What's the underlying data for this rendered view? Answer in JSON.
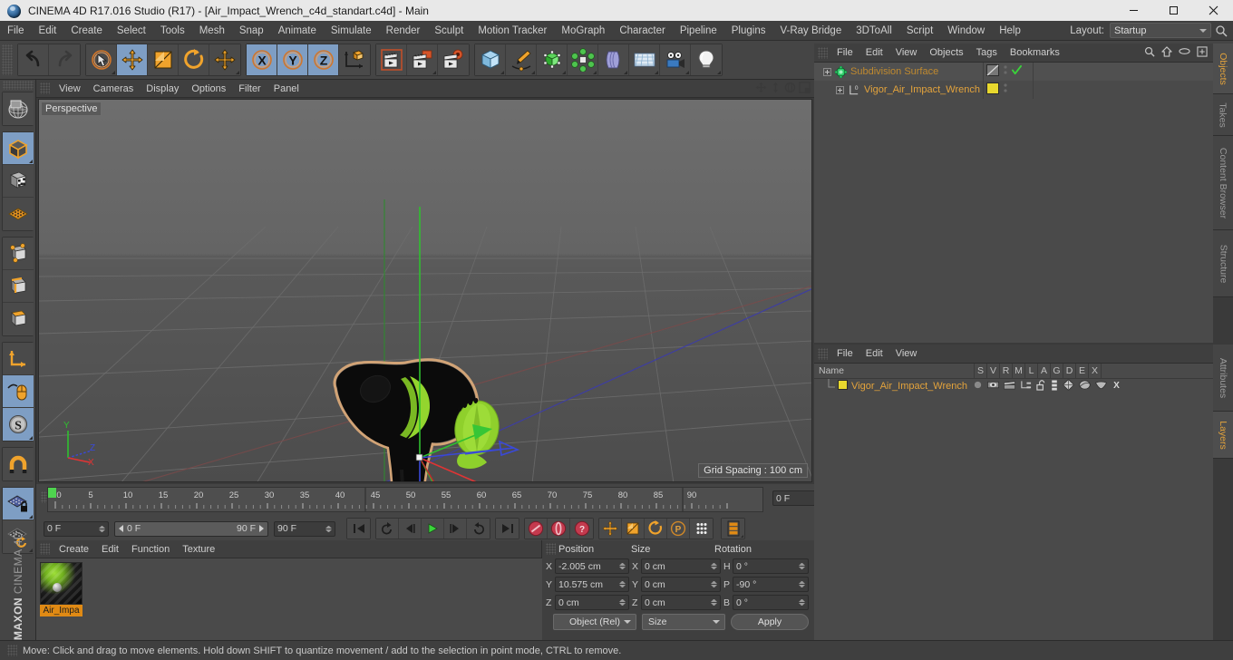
{
  "window": {
    "title": "CINEMA 4D R17.016 Studio (R17) - [Air_Impact_Wrench_c4d_standart.c4d] - Main",
    "minimize": "minimize-button",
    "maximize": "maximize-button",
    "close": "close-button"
  },
  "menubar": {
    "items": [
      "File",
      "Edit",
      "Create",
      "Select",
      "Tools",
      "Mesh",
      "Snap",
      "Animate",
      "Simulate",
      "Render",
      "Sculpt",
      "Motion Tracker",
      "MoGraph",
      "Character",
      "Pipeline",
      "Plugins",
      "V-Ray Bridge",
      "3DToAll",
      "Script",
      "Window",
      "Help"
    ],
    "layout_label": "Layout:",
    "layout_value": "Startup"
  },
  "toolbar": {
    "groups": [
      {
        "name": "history",
        "buttons": [
          {
            "name": "undo-button",
            "icon": "undo-arrow-icon",
            "active": false,
            "corner": false
          },
          {
            "name": "redo-button",
            "icon": "redo-arrow-icon",
            "active": false,
            "corner": false
          }
        ]
      },
      {
        "name": "tools",
        "buttons": [
          {
            "name": "live-selection-tool",
            "icon": "cursor-circle-icon",
            "active": false,
            "corner": true
          },
          {
            "name": "move-tool",
            "icon": "move-arrows-icon",
            "active": true,
            "corner": false
          },
          {
            "name": "scale-tool",
            "icon": "scale-box-icon",
            "active": false,
            "corner": false
          },
          {
            "name": "rotate-tool",
            "icon": "rotate-arc-icon",
            "active": false,
            "corner": false
          },
          {
            "name": "transform-tool",
            "icon": "move-arrows-icon",
            "active": false,
            "corner": true
          }
        ]
      },
      {
        "name": "axis-locks",
        "buttons": [
          {
            "name": "x-axis-lock",
            "icon": "x-axis-icon",
            "label": "X",
            "active": true,
            "corner": false
          },
          {
            "name": "y-axis-lock",
            "icon": "y-axis-icon",
            "label": "Y",
            "active": true,
            "corner": false
          },
          {
            "name": "z-axis-lock",
            "icon": "z-axis-icon",
            "label": "Z",
            "active": true,
            "corner": false
          },
          {
            "name": "world-object-coord-toggle",
            "icon": "world-axis-cube-icon",
            "active": false,
            "corner": false
          }
        ]
      },
      {
        "name": "render",
        "buttons": [
          {
            "name": "render-view-button",
            "icon": "clapper-render-icon",
            "active": false,
            "corner": false
          },
          {
            "name": "render-to-picture-viewer-button",
            "icon": "clapper-picture-icon",
            "active": false,
            "corner": true
          },
          {
            "name": "render-settings-button",
            "icon": "clapper-gear-icon",
            "active": false,
            "corner": false
          }
        ]
      },
      {
        "name": "create",
        "buttons": [
          {
            "name": "add-cube-object-button",
            "icon": "blue-cube-icon",
            "active": false,
            "corner": true
          },
          {
            "name": "add-spline-button",
            "icon": "pen-spline-icon",
            "active": false,
            "corner": true
          },
          {
            "name": "add-generator-button",
            "icon": "green-cube-cage-icon",
            "active": false,
            "corner": true
          },
          {
            "name": "add-array-button",
            "icon": "green-cluster-icon",
            "active": false,
            "corner": true
          },
          {
            "name": "add-deformer-button",
            "icon": "bend-deformer-icon",
            "active": false,
            "corner": true
          },
          {
            "name": "add-scene-object-button",
            "icon": "floor-grid-icon",
            "active": false,
            "corner": true
          },
          {
            "name": "add-camera-button",
            "icon": "camera-icon",
            "active": false,
            "corner": true
          },
          {
            "name": "add-light-button",
            "icon": "light-bulb-icon",
            "active": false,
            "corner": true
          }
        ]
      }
    ]
  },
  "left_toolbar": {
    "groups": [
      {
        "name": "group-a",
        "buttons": [
          {
            "name": "make-editable-button",
            "icon": "globe-wire-icon",
            "active": false,
            "corner": false
          }
        ]
      },
      {
        "name": "group-modes",
        "buttons": [
          {
            "name": "model-mode-button",
            "icon": "model-cube-icon",
            "active": true,
            "corner": true
          },
          {
            "name": "texture-mode-button",
            "icon": "texture-cube-icon",
            "active": false,
            "corner": false
          },
          {
            "name": "workplane-mode-button",
            "icon": "orange-grid-icon",
            "active": false,
            "corner": false
          }
        ]
      },
      {
        "name": "group-components",
        "buttons": [
          {
            "name": "points-mode-button",
            "icon": "points-cube-icon",
            "active": false,
            "corner": false
          },
          {
            "name": "edges-mode-button",
            "icon": "edges-cube-icon",
            "active": false,
            "corner": false
          },
          {
            "name": "polygons-mode-button",
            "icon": "polygons-cube-icon",
            "active": false,
            "corner": false
          }
        ]
      },
      {
        "name": "group-axis",
        "buttons": [
          {
            "name": "enable-axis-modification-button",
            "icon": "axis-corner-icon",
            "active": false,
            "corner": false
          },
          {
            "name": "viewport-solo-button",
            "icon": "mouse-icon",
            "active": true,
            "corner": false
          },
          {
            "name": "soft-selection-button",
            "icon": "s-circle-icon",
            "active": true,
            "corner": true
          }
        ]
      },
      {
        "name": "group-snap",
        "buttons": [
          {
            "name": "enable-snap-button",
            "icon": "magnet-icon",
            "active": false,
            "corner": false
          }
        ]
      },
      {
        "name": "group-workplane",
        "buttons": [
          {
            "name": "lock-workplane-button",
            "icon": "workplane-lock-icon",
            "active": true,
            "corner": true
          },
          {
            "name": "planar-workplane-button",
            "icon": "workplane-rotate-icon",
            "active": false,
            "corner": true
          }
        ]
      }
    ],
    "brand_bold": "MAXON",
    "brand_light": "CINEMA 4D"
  },
  "viewport": {
    "menu": [
      "View",
      "Cameras",
      "Display",
      "Options",
      "Filter",
      "Panel"
    ],
    "label": "Perspective",
    "grid_spacing": "Grid Spacing : 100 cm",
    "axis_x": "X",
    "axis_y": "Y",
    "axis_z": "Z",
    "nav_icons": [
      "pan-viewport-icon",
      "dolly-viewport-icon",
      "rotate-viewport-icon",
      "maximize-viewport-icon"
    ],
    "object_colors": {
      "body": "#0a0a0a",
      "accent": "#8ed02c",
      "selection_outline": "#d8a878",
      "axis_x": "#e03434",
      "axis_y": "#34c034",
      "axis_z": "#3a49d8"
    }
  },
  "timeline": {
    "ticks": [
      0,
      5,
      10,
      15,
      20,
      25,
      30,
      35,
      40,
      45,
      50,
      55,
      60,
      65,
      70,
      75,
      80,
      85,
      90
    ],
    "current_frame_field": "0 F",
    "start_frame": "0 F",
    "preview_start": "0 F",
    "preview_end": "90 F",
    "end_frame": "90 F",
    "transport": [
      {
        "name": "go-to-start-button",
        "icon": "skip-start-icon"
      },
      {
        "name": "play-backwards-loop-button",
        "icon": "loop-back-icon"
      },
      {
        "name": "step-back-button",
        "icon": "step-back-icon"
      },
      {
        "name": "play-button",
        "icon": "play-icon"
      },
      {
        "name": "step-forward-button",
        "icon": "step-forward-icon"
      },
      {
        "name": "play-forward-loop-button",
        "icon": "loop-forward-icon"
      },
      {
        "name": "go-to-end-button",
        "icon": "skip-end-icon"
      }
    ],
    "keyframe_buttons": [
      {
        "name": "record-active-objects-button",
        "icon": "record-key-icon"
      },
      {
        "name": "autokeying-button",
        "icon": "autokey-icon"
      },
      {
        "name": "keyframe-selection-button",
        "icon": "key-question-icon"
      }
    ],
    "key_channel_buttons": [
      {
        "name": "position-key-button",
        "icon": "move-arrows-icon"
      },
      {
        "name": "scale-key-button",
        "icon": "scale-box-icon"
      },
      {
        "name": "rotation-key-button",
        "icon": "rotate-arc-icon"
      },
      {
        "name": "parameter-key-button",
        "icon": "p-circle-icon"
      },
      {
        "name": "point-level-animation-button",
        "icon": "pla-dots-icon"
      }
    ],
    "extra_button": {
      "name": "animation-layout-button",
      "icon": "film-strip-icon"
    }
  },
  "material_manager": {
    "menu": [
      "Create",
      "Edit",
      "Function",
      "Texture"
    ],
    "materials": [
      {
        "name": "Air_Impa",
        "selected": true
      }
    ]
  },
  "coordinates": {
    "headers": [
      "Position",
      "Size",
      "Rotation"
    ],
    "rows": [
      {
        "pos_label": "X",
        "pos_value": "-2.005 cm",
        "size_label": "X",
        "size_value": "0 cm",
        "rot_label": "H",
        "rot_value": "0 °"
      },
      {
        "pos_label": "Y",
        "pos_value": "10.575 cm",
        "size_label": "Y",
        "size_value": "0 cm",
        "rot_label": "P",
        "rot_value": "-90 °"
      },
      {
        "pos_label": "Z",
        "pos_value": "0 cm",
        "size_label": "Z",
        "size_value": "0 cm",
        "rot_label": "B",
        "rot_value": "0 °"
      }
    ],
    "coord_system": "Object (Rel)",
    "size_mode": "Size",
    "apply_label": "Apply"
  },
  "object_manager": {
    "menu": [
      "File",
      "Edit",
      "View",
      "Objects",
      "Tags",
      "Bookmarks"
    ],
    "header_icons": [
      "search-icon",
      "home-icon",
      "ellipse-icon",
      "new-layout-icon"
    ],
    "rows": [
      {
        "name": "Subdivision Surface",
        "icon": "subdivision-surface-icon",
        "indent": 0,
        "selected": true,
        "tag_swatch": "diagonal",
        "check": true
      },
      {
        "name": "Vigor_Air_Impact_Wrench",
        "icon": "polygon-object-icon",
        "indent": 1,
        "selected": false,
        "tag_swatch": "#e8d82e",
        "check": false
      }
    ]
  },
  "layers_manager": {
    "menu": [
      "File",
      "Edit",
      "View"
    ],
    "columns": [
      "Name",
      "S",
      "V",
      "R",
      "M",
      "L",
      "A",
      "G",
      "D",
      "E",
      "X"
    ],
    "rows": [
      {
        "name": "Vigor_Air_Impact_Wrench",
        "color": "#e8d82e",
        "icons": [
          "solo-dot-icon",
          "view-eye-icon",
          "render-clapper-icon",
          "manager-tree-icon",
          "lock-open-icon",
          "animation-bars-icon",
          "generator-icon",
          "deformer-icon",
          "expression-icon",
          "xpresso-icon"
        ]
      }
    ]
  },
  "side_tabs": {
    "top": [
      "Objects",
      "Takes",
      "Content Browser",
      "Structure"
    ],
    "top_active": "Objects",
    "bottom": [
      "Attributes",
      "Layers"
    ],
    "bottom_active": "Layers"
  },
  "statusbar": {
    "text": "Move: Click and drag to move elements. Hold down SHIFT to quantize movement / add to the selection in point mode, CTRL to remove."
  }
}
